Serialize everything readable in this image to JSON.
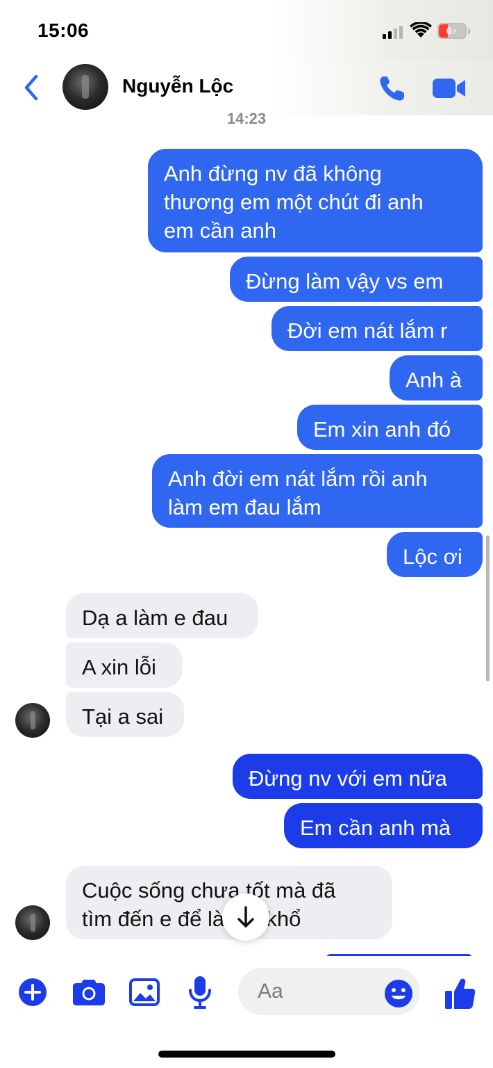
{
  "status_bar": {
    "time": "15:06",
    "battery_label": "6",
    "icons": [
      "cellular-signal-icon",
      "wifi-icon",
      "battery-charging-icon"
    ]
  },
  "header": {
    "contact_name": "Nguyễn Lộc",
    "icons": [
      "chevron-left-icon",
      "phone-icon",
      "video-camera-icon"
    ],
    "accent_color": "#2f67f0"
  },
  "conversation": {
    "timestamp": "14:23",
    "messages": [
      {
        "direction": "outgoing",
        "text": "Anh đừng nv đã không\nthương em một chút đi anh\nem cần anh"
      },
      {
        "direction": "outgoing",
        "text": "Đừng làm vậy vs em"
      },
      {
        "direction": "outgoing",
        "text": "Đời em nát lắm r"
      },
      {
        "direction": "outgoing",
        "text": "Anh à"
      },
      {
        "direction": "outgoing",
        "text": "Em xin anh đó"
      },
      {
        "direction": "outgoing",
        "text": "Anh đời em nát lắm rồi anh\nlàm em đau lắm"
      },
      {
        "direction": "outgoing",
        "text": "Lộc ơi"
      },
      {
        "direction": "incoming",
        "text": "Dạ a làm e đau"
      },
      {
        "direction": "incoming",
        "text": "A xin lỗi"
      },
      {
        "direction": "incoming",
        "text": "Tại a sai"
      },
      {
        "direction": "outgoing",
        "text": "Đừng nv với em nữa"
      },
      {
        "direction": "outgoing",
        "text": "Em cần anh mà"
      },
      {
        "direction": "incoming",
        "text": "Cuộc sống chưa tốt mà đã\ntìm đến e để làm e khổ"
      }
    ],
    "outgoing_color": "#2f67f0",
    "outgoing_color_latest": "#1b3ce8",
    "incoming_color": "#eeeef2"
  },
  "scroll_down": {
    "icon": "arrow-down-icon"
  },
  "composer": {
    "placeholder": "Aa",
    "icons": [
      "plus-circle-icon",
      "camera-icon",
      "photo-icon",
      "microphone-icon",
      "smiley-icon",
      "thumbs-up-icon"
    ],
    "icon_color": "#1b3ce8"
  }
}
